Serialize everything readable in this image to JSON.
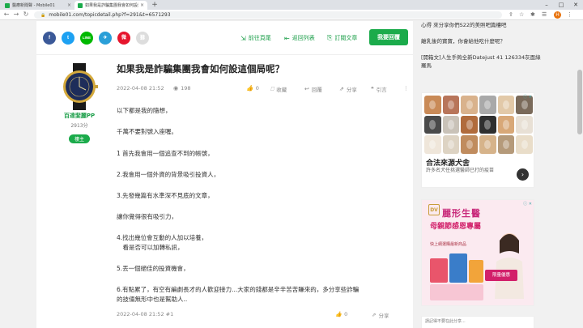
{
  "browser": {
    "tabs": [
      {
        "label": "醫療新聞聲 - Mobile01"
      },
      {
        "label": "如果我是詐騙集團我會如何設這個局呢？"
      }
    ],
    "url": "mobile01.com/topicdetail.php?f=291&t=6571293",
    "profile_initial": "H"
  },
  "sharebar": {
    "social": [
      "f",
      "t",
      "LINE",
      "✈",
      "微",
      "⛓"
    ],
    "back_to_forum": "前往頁尾",
    "back_to_list": "返回列表",
    "subscribe": "訂閱文章",
    "reply": "我要回覆"
  },
  "author": {
    "name": "百達斐麗PP",
    "points": "2913分",
    "badge": "樓主"
  },
  "post": {
    "title": "如果我是詐騙集團我會如何設這個局呢？",
    "date": "2022-04-08 21:52",
    "views": "198",
    "likes": "0",
    "actions": [
      "收藏",
      "回覆",
      "分享",
      "引言"
    ],
    "paragraphs": [
      "以下都是我的隨想，",
      "千萬不要對號入座喔。",
      "1 首先我會用一個追查不到的帳號，",
      "2.我會用一個外資的背景吸引投資人，",
      "3.先發幾篇有水準深不見底的文章，",
      "讓你覺得很有吸引力，",
      "4.找出幾位會互動的人加以培養，",
      "　看是否可以加轉私訊，",
      "5.丟一個絕佳的投資機會，",
      "6.有點累了，有空有編劇長才的人歡迎接力...大家的錢都是辛辛苦苦賺來的，多分享些詐騙",
      "的技倆無形中也是幫助人.."
    ],
    "footer_date": "2022-04-08 21:52 #1",
    "footer_likes": "0",
    "footer_share": "分享"
  },
  "sidebar": {
    "links": [
      "心得 來分享你們S22的美照吧篇樓吧",
      "離乳後的寶寶，你會給他吃什麼呢？",
      "[開箱文]人生手夠全新Datejust 41 126334灰面綠羅馬"
    ],
    "ad1": {
      "title": "合法來源犬舍",
      "subtitle": "許多名犬任挑選醫師已打的疫苗",
      "tag": "ⓘ ✕"
    },
    "ad2": {
      "brand": "麗形生醫",
      "logo": "DV",
      "slogan": "母親節感恩專屬",
      "small": "快上網選購最新商品",
      "price": "限量優惠",
      "tag": "ⓘ ✕"
    },
    "ad3": {
      "text": "請記得不要在此分享..."
    }
  }
}
